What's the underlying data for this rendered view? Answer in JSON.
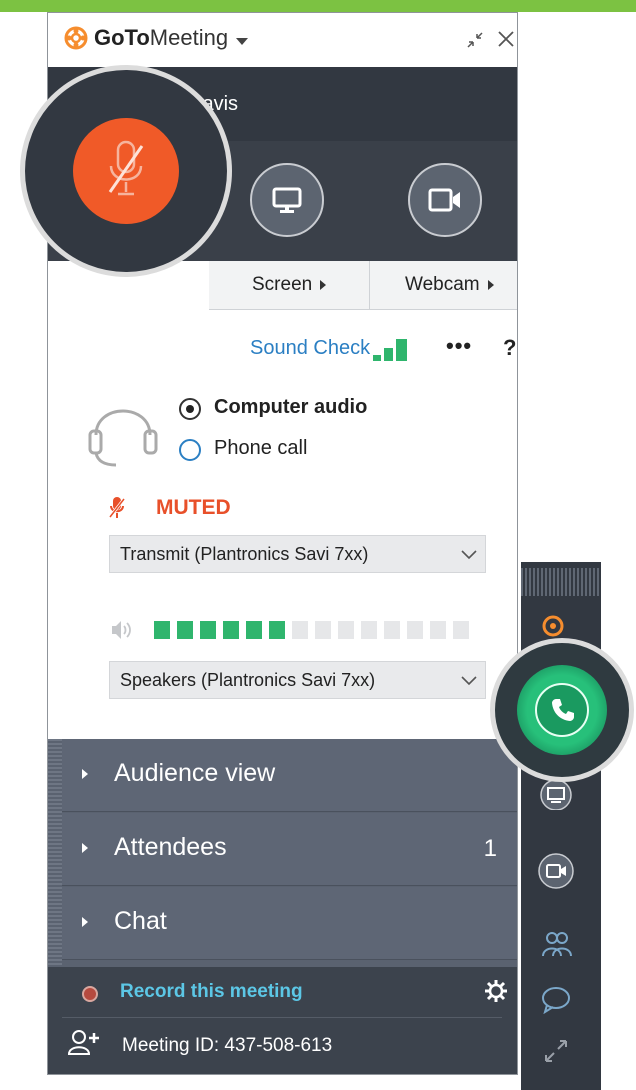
{
  "window": {
    "app_title_bold": "GoTo",
    "app_title_rest": "Meeting",
    "user_name": "Davis"
  },
  "controls": {
    "screen_tab": "Screen",
    "webcam_tab": "Webcam"
  },
  "audio": {
    "sound_check": "Sound Check",
    "more": "•••",
    "help": "?",
    "option_computer": "Computer audio",
    "option_phone": "Phone call",
    "selected": "Computer audio",
    "muted": "MUTED",
    "mic_device": "Transmit (Plantronics Savi 7xx)",
    "speaker_device": "Speakers (Plantronics Savi 7xx)",
    "speaker_level_segments_on": 6,
    "speaker_level_segments_total": 14
  },
  "panels": [
    {
      "label": "Audience view",
      "count": ""
    },
    {
      "label": "Attendees",
      "count": "1"
    },
    {
      "label": "Chat",
      "count": ""
    }
  ],
  "footer": {
    "record": "Record this meeting",
    "meeting_id": "Meeting ID: 437-508-613"
  },
  "colors": {
    "accent_green": "#7cc242",
    "mute_orange": "#f05a28",
    "call_green": "#1fa56a",
    "link_blue": "#2b7fc3",
    "record_cyan": "#5cc7e6",
    "meter_green": "#2fb56d"
  },
  "icons": [
    "gotomeeting-logo-icon",
    "minimize-icon",
    "close-icon",
    "mic-muted-icon",
    "screen-icon",
    "webcam-icon",
    "headset-icon",
    "speaker-icon",
    "gear-icon",
    "add-person-icon",
    "phone-icon",
    "attendees-icon",
    "chat-icon",
    "expand-icon"
  ]
}
